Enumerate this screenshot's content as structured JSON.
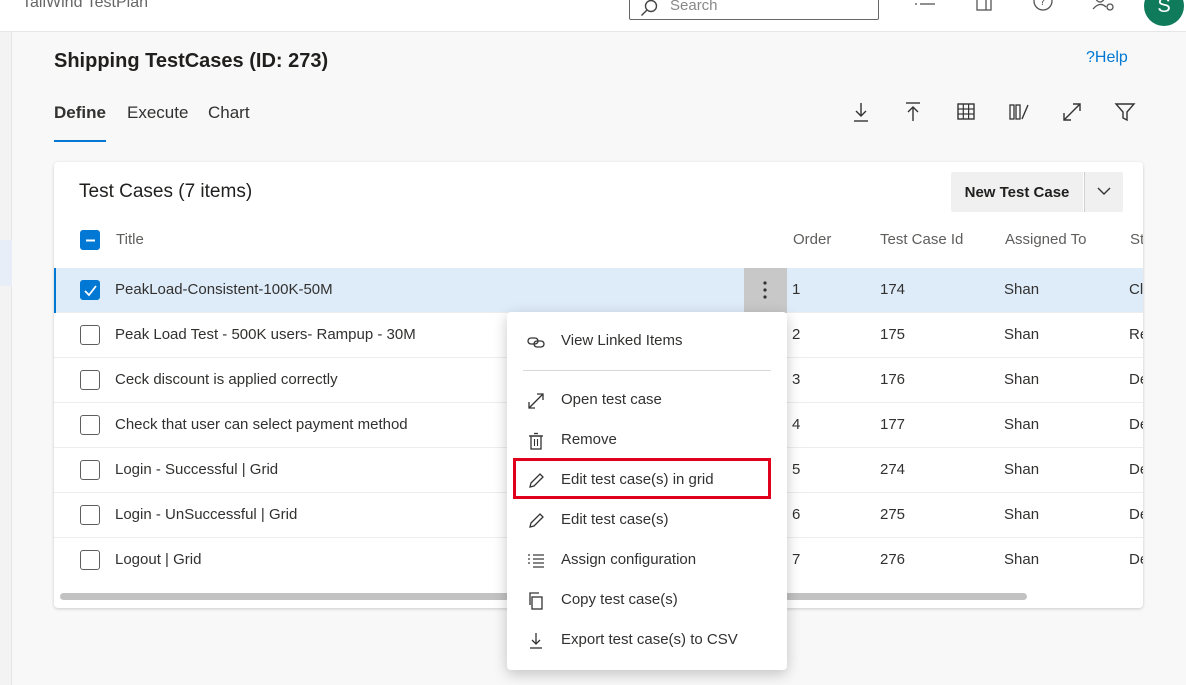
{
  "topbar": {
    "app_title": "TailWind TestPlan",
    "search_placeholder": "Search",
    "avatar_initial": "S",
    "icons": [
      "list-icon",
      "book-icon",
      "help-circle-icon",
      "user-settings-icon"
    ]
  },
  "header": {
    "title": "Shipping TestCases (ID: 273)",
    "help_label": "?Help",
    "tabs": [
      {
        "label": "Define",
        "active": true
      },
      {
        "label": "Execute",
        "active": false
      },
      {
        "label": "Chart",
        "active": false
      }
    ],
    "toolbar_icons": [
      "download-icon",
      "upload-icon",
      "grid-icon",
      "column-options-icon",
      "expand-icon",
      "filter-icon"
    ]
  },
  "card": {
    "title": "Test Cases (7 items)",
    "new_button_label": "New Test Case",
    "columns": [
      "Title",
      "Order",
      "Test Case Id",
      "Assigned To",
      "St"
    ],
    "rows": [
      {
        "title": "PeakLoad-Consistent-100K-50M",
        "order": "1",
        "id": "174",
        "assigned": "Shan",
        "state": "Cl",
        "selected": true
      },
      {
        "title": "Peak Load Test - 500K users- Rampup - 30M",
        "order": "2",
        "id": "175",
        "assigned": "Shan",
        "state": "Re",
        "selected": false
      },
      {
        "title": "Ceck discount is applied correctly",
        "order": "3",
        "id": "176",
        "assigned": "Shan",
        "state": "De",
        "selected": false
      },
      {
        "title": "Check that user can select payment method",
        "order": "4",
        "id": "177",
        "assigned": "Shan",
        "state": "De",
        "selected": false
      },
      {
        "title": "Login - Successful | Grid",
        "order": "5",
        "id": "274",
        "assigned": "Shan",
        "state": "De",
        "selected": false
      },
      {
        "title": "Login - UnSuccessful | Grid",
        "order": "6",
        "id": "275",
        "assigned": "Shan",
        "state": "De",
        "selected": false
      },
      {
        "title": "Logout | Grid",
        "order": "7",
        "id": "276",
        "assigned": "Shan",
        "state": "De",
        "selected": false
      }
    ]
  },
  "context_menu": {
    "items": [
      {
        "label": "View Linked Items",
        "icon": "link-icon"
      },
      {
        "label": "Open test case",
        "icon": "open-diagonal-icon"
      },
      {
        "label": "Remove",
        "icon": "trash-icon"
      },
      {
        "label": "Edit test case(s) in grid",
        "icon": "pencil-icon",
        "highlighted": true
      },
      {
        "label": "Edit test case(s)",
        "icon": "pencil-icon"
      },
      {
        "label": "Assign configuration",
        "icon": "list-check-icon"
      },
      {
        "label": "Copy test case(s)",
        "icon": "copy-icon"
      },
      {
        "label": "Export test case(s) to CSV",
        "icon": "download-icon"
      }
    ]
  },
  "colors": {
    "accent": "#0078d4",
    "selected_row": "#deecf9",
    "highlight": "#e0001b",
    "avatar": "#0f7b5b"
  }
}
